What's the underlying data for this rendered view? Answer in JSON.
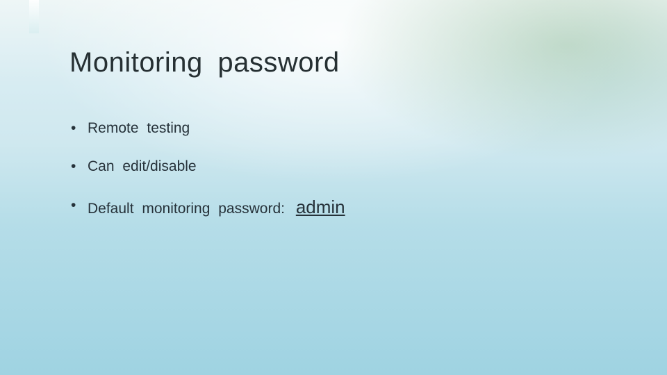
{
  "slide": {
    "title": "Monitoring password",
    "bullets": [
      {
        "text": "Remote testing"
      },
      {
        "text": "Can edit/disable"
      },
      {
        "text": "Default monitoring password:",
        "emphasis": "admin"
      }
    ]
  }
}
